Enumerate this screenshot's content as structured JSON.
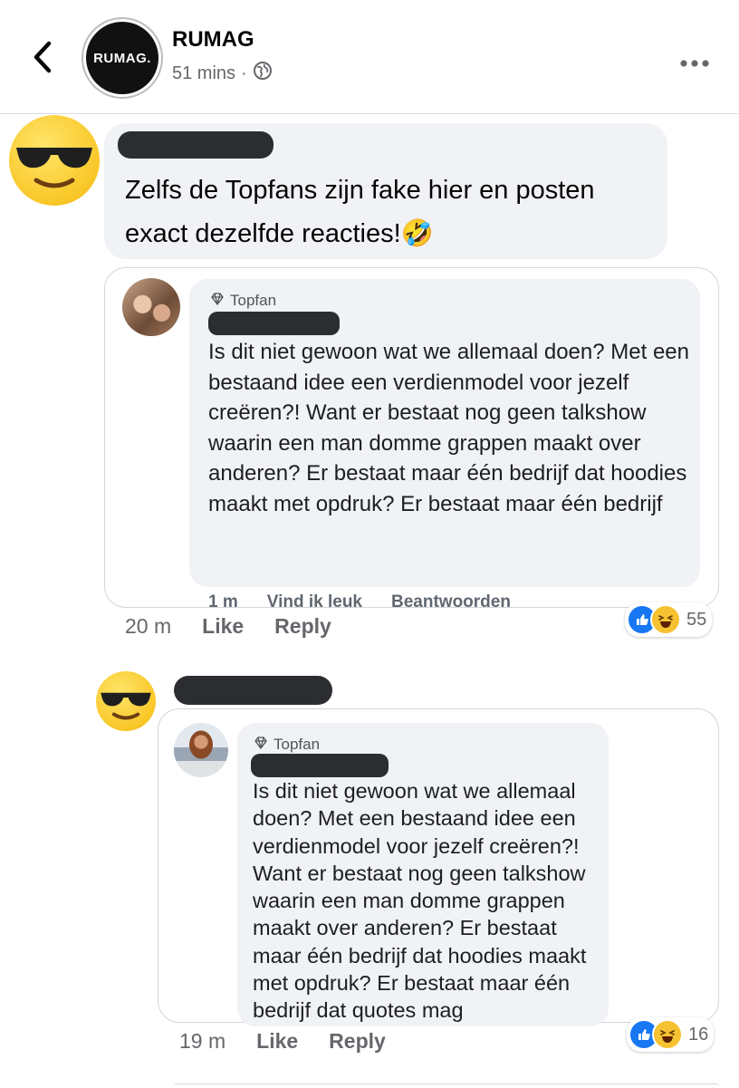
{
  "header": {
    "page_name": "RUMAG",
    "logo_text": "RUMAG.",
    "time": "51 mins",
    "separator": "·"
  },
  "comments": [
    {
      "text": "Zelfs de Topfans zijn fake hier en posten exact dezelfde reacties!",
      "emoji": "🤣",
      "embedded": {
        "badge": "Topfan",
        "text": "Is dit niet gewoon wat we allemaal doen? Met een bestaand idee een verdienmodel voor jezelf creëren?! Want er bestaat nog geen talkshow waarin een man domme grappen maakt over anderen? Er bestaat maar één bedrijf dat hoodies maakt met opdruk? Er bestaat maar één bedrijf",
        "meta": [
          "1 m",
          "Vind ik leuk",
          "Beantwoorden"
        ]
      },
      "time": "20 m",
      "like_label": "Like",
      "reply_label": "Reply",
      "reaction_count": "55"
    },
    {
      "embedded": {
        "badge": "Topfan",
        "text": "Is dit niet gewoon wat we allemaal doen? Met een bestaand idee een verdienmodel voor jezelf creëren?! Want er bestaat nog geen talkshow waarin een man domme grappen maakt over anderen? Er bestaat maar één bedrijf dat hoodies maakt met opdruk? Er bestaat maar één bedrijf dat quotes mag"
      },
      "time": "19 m",
      "like_label": "Like",
      "reply_label": "Reply",
      "reaction_count": "16"
    }
  ],
  "icons": [
    "back-chevron-icon",
    "globe-icon",
    "more-dots-icon",
    "sunglasses-emoji-icon",
    "diamond-icon",
    "like-reaction-icon",
    "haha-reaction-icon"
  ]
}
